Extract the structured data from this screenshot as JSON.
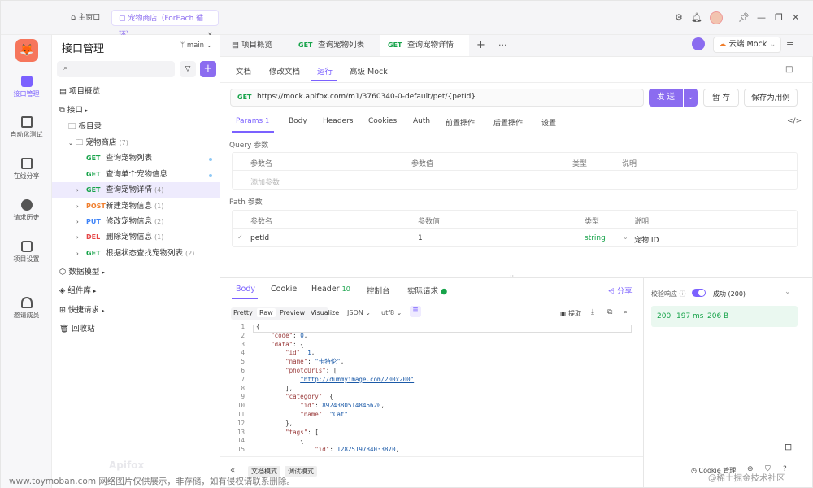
{
  "window_tabs": [
    {
      "label": "主窗口",
      "active": false
    },
    {
      "label": "宠物商店（ForEach 循环）",
      "active": true,
      "close": "×"
    }
  ],
  "rail": [
    {
      "label": "接口管理",
      "icon": "api-icon",
      "active": true
    },
    {
      "label": "自动化测试",
      "icon": "test-icon"
    },
    {
      "label": "在线分享",
      "icon": "share-icon"
    },
    {
      "label": "请求历史",
      "icon": "history-icon"
    },
    {
      "label": "项目设置",
      "icon": "settings-icon"
    },
    {
      "label": "邀请成员",
      "icon": "invite-icon"
    }
  ],
  "sidebar": {
    "title": "接口管理",
    "branch": "main",
    "plus": "+",
    "items": [
      {
        "label": "项目概览"
      },
      {
        "label": "接口"
      },
      {
        "label": "根目录"
      },
      {
        "label": "宠物商店",
        "count": "(7)"
      },
      {
        "method": "GET",
        "label": "查询宠物列表"
      },
      {
        "method": "GET",
        "label": "查询单个宠物信息"
      },
      {
        "method": "GET",
        "label": "查询宠物详情",
        "count": "(4)"
      },
      {
        "method": "POST",
        "label": "新建宠物信息",
        "count": "(1)"
      },
      {
        "method": "PUT",
        "label": "修改宠物信息",
        "count": "(2)"
      },
      {
        "method": "DEL",
        "label": "删除宠物信息",
        "count": "(1)"
      },
      {
        "method": "GET",
        "label": "根据状态查找宠物列表",
        "count": "(2)"
      },
      {
        "label": "数据模型"
      },
      {
        "label": "组件库"
      },
      {
        "label": "快捷请求"
      },
      {
        "label": "回收站"
      }
    ]
  },
  "page_tabs": [
    {
      "label": "项目概览"
    },
    {
      "method": "GET",
      "label": "查询宠物列表"
    },
    {
      "method": "GET",
      "label": "查询宠物详情",
      "active": true
    }
  ],
  "env": {
    "label": "云端 Mock"
  },
  "sub_tabs": [
    {
      "label": "文档"
    },
    {
      "label": "修改文档"
    },
    {
      "label": "运行",
      "active": true
    },
    {
      "label": "高级 Mock"
    }
  ],
  "request": {
    "method": "GET",
    "url": "https://mock.apifox.com/m1/3760340-0-default/pet/{petId}",
    "send": "发 送",
    "save": "暂 存",
    "save_as": "保存为用例"
  },
  "req_tabs": [
    {
      "label": "Params",
      "badge": "1",
      "active": true
    },
    {
      "label": "Body"
    },
    {
      "label": "Headers"
    },
    {
      "label": "Cookies"
    },
    {
      "label": "Auth"
    },
    {
      "label": "前置操作"
    },
    {
      "label": "后置操作"
    },
    {
      "label": "设置"
    }
  ],
  "query": {
    "title": "Query 参数",
    "cols": [
      "参数名",
      "参数值",
      "类型",
      "说明"
    ],
    "placeholder": "添加参数"
  },
  "path": {
    "title": "Path 参数",
    "cols": [
      "参数名",
      "参数值",
      "类型",
      "说明"
    ],
    "row": {
      "name": "petId",
      "value": "1",
      "type": "string",
      "desc": "宠物 ID"
    }
  },
  "resp_tabs": [
    {
      "label": "Body",
      "active": true
    },
    {
      "label": "Cookie"
    },
    {
      "label": "Header",
      "badge": "10"
    },
    {
      "label": "控制台"
    },
    {
      "label": "实际请求"
    }
  ],
  "share": "分享",
  "view_tabs": [
    "Pretty",
    "Raw",
    "Preview",
    "Visualize"
  ],
  "format": "JSON",
  "encoding": "utf8",
  "extract": "提取",
  "validate": {
    "label": "校验响应",
    "result": "成功 (200)"
  },
  "stats": {
    "status": "200",
    "time": "197 ms",
    "size": "206 B"
  },
  "code_lines": [
    "{",
    "    \"code\": 0,",
    "    \"data\": {",
    "        \"id\": 1,",
    "        \"name\": \"卡特伦\",",
    "        \"photoUrls\": [",
    "            \"http://dummyimage.com/200x200\"",
    "        ],",
    "        \"category\": {",
    "            \"id\": 8924380514846620,",
    "            \"name\": \"Cat\"",
    "        },",
    "        \"tags\": [",
    "            {",
    "                \"id\": 1282519784033870,"
  ],
  "bottom": {
    "mode1": "文档模式",
    "mode2": "调试模式",
    "cookie": "Cookie 管理"
  },
  "watermark_left": "www.toymoban.com 网络图片仅供展示，非存储，如有侵权请联系删除。",
  "watermark_right": "@稀土掘金技术社区",
  "logo_text": "Apifox"
}
